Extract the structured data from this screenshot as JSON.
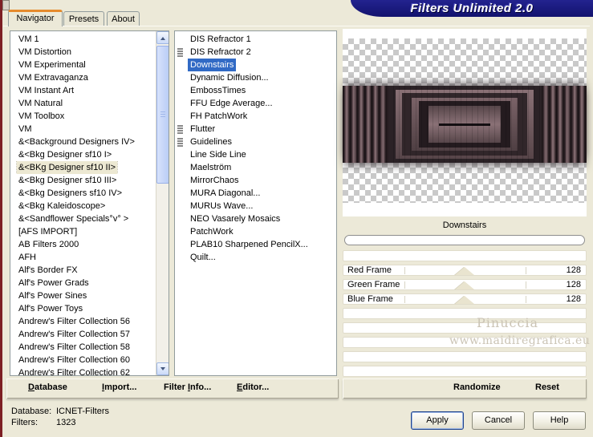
{
  "title": "Filters Unlimited 2.0",
  "colors": {
    "title_banner": "#15157E",
    "selection_blue": "#316AC5",
    "dialog_bg": "#ECE9D8",
    "left_stripe_maroon": "#7D1F24",
    "active_tab_accent": "#E68B2C"
  },
  "tabs": {
    "navigator": "Navigator",
    "presets": "Presets",
    "about": "About"
  },
  "category_list": {
    "selected_index": 10,
    "items": [
      "VM 1",
      "VM Distortion",
      "VM Experimental",
      "VM Extravaganza",
      "VM Instant Art",
      "VM Natural",
      "VM Toolbox",
      "VM",
      "&<Background Designers IV>",
      "&<Bkg Designer sf10 I>",
      "&<BKg Designer sf10 II>",
      "&<Bkg Designer sf10 III>",
      "&<Bkg Designers sf10 IV>",
      "&<Bkg Kaleidoscope>",
      "&<Sandflower Specials°v° >",
      "[AFS IMPORT]",
      "AB Filters 2000",
      "AFH",
      "Alf's Border FX",
      "Alf's Power Grads",
      "Alf's Power Sines",
      "Alf's Power Toys",
      "Andrew's Filter Collection 56",
      "Andrew's Filter Collection 57",
      "Andrew's Filter Collection 58",
      "Andrew's Filter Collection 60",
      "Andrew's Filter Collection 62"
    ]
  },
  "filter_list": {
    "selected_index": 2,
    "items": [
      {
        "label": "DIS Refractor 1",
        "has_icon": false
      },
      {
        "label": "DIS Refractor 2",
        "has_icon": true
      },
      {
        "label": "Downstairs",
        "has_icon": false
      },
      {
        "label": "Dynamic Diffusion...",
        "has_icon": false
      },
      {
        "label": "EmbossTimes",
        "has_icon": false
      },
      {
        "label": "FFU Edge Average...",
        "has_icon": false
      },
      {
        "label": "FH PatchWork",
        "has_icon": false
      },
      {
        "label": "Flutter",
        "has_icon": true
      },
      {
        "label": "Guidelines",
        "has_icon": true
      },
      {
        "label": "Line Side Line",
        "has_icon": false
      },
      {
        "label": "Maelström",
        "has_icon": false
      },
      {
        "label": "MirrorChaos",
        "has_icon": false
      },
      {
        "label": "MURA Diagonal...",
        "has_icon": false
      },
      {
        "label": "MURUs Wave...",
        "has_icon": false
      },
      {
        "label": "NEO Vasarely Mosaics",
        "has_icon": false
      },
      {
        "label": "PatchWork",
        "has_icon": false
      },
      {
        "label": "PLAB10 Sharpened PencilX...",
        "has_icon": false
      },
      {
        "label": "Quilt...",
        "has_icon": false
      }
    ]
  },
  "preview": {
    "caption": "Downstairs",
    "progress_percent": 0
  },
  "sliders": [
    {
      "label": "Red Frame",
      "value": "128"
    },
    {
      "label": "Green Frame",
      "value": "128"
    },
    {
      "label": "Blue Frame",
      "value": "128"
    }
  ],
  "watermark": {
    "line1": "Pinuccia",
    "line2": "www.maidiregrafica.eu"
  },
  "menubar": {
    "database": {
      "pre": "",
      "accel": "D",
      "rest": "atabase"
    },
    "import": {
      "pre": "",
      "accel": "I",
      "rest": "mport..."
    },
    "filter_info": {
      "pre": "Filter ",
      "accel": "I",
      "rest": "nfo..."
    },
    "editor": {
      "pre": "",
      "accel": "E",
      "rest": "ditor..."
    },
    "randomize": "Randomize",
    "reset": "Reset"
  },
  "status": {
    "database_label": "Database:",
    "database_value": "ICNET-Filters",
    "filters_label": "Filters:",
    "filters_value": "1323"
  },
  "action_buttons": {
    "apply": "Apply",
    "cancel": "Cancel",
    "help": "Help"
  }
}
